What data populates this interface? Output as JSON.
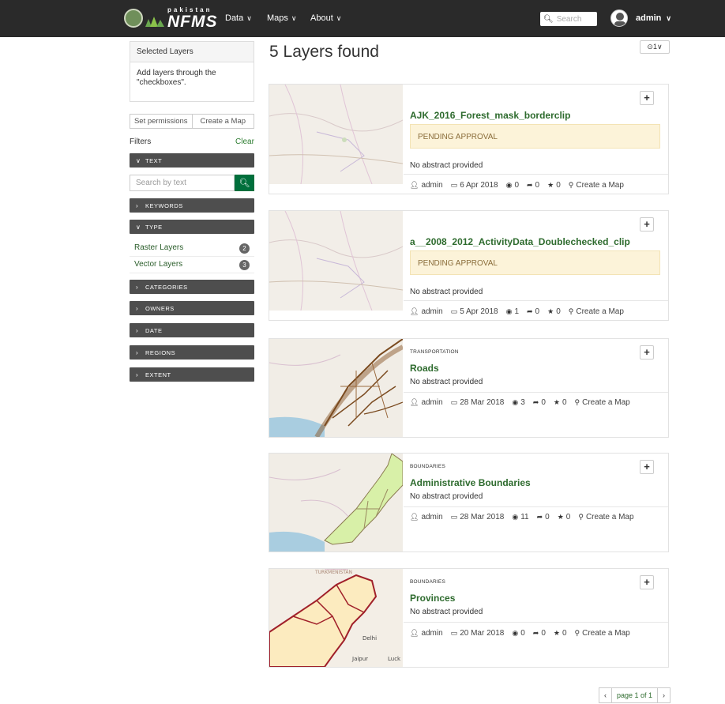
{
  "nav": {
    "logo_small": "pakistan",
    "logo_big": "NFMS",
    "menu": [
      "Data",
      "Maps",
      "About"
    ],
    "search_placeholder": "Search",
    "user": "admin"
  },
  "sidebar": {
    "selected_title": "Selected Layers",
    "selected_hint": "Add layers through the \"checkboxes\".",
    "set_permissions": "Set permissions",
    "create_map": "Create a Map",
    "filters_label": "Filters",
    "clear_label": "Clear",
    "facets": {
      "text": "TEXT",
      "keywords": "KEYWORDS",
      "type": "TYPE",
      "categories": "CATEGORIES",
      "owners": "OWNERS",
      "date": "DATE",
      "regions": "REGIONS",
      "extent": "EXTENT"
    },
    "search_placeholder": "Search by text",
    "types": [
      {
        "label": "Raster Layers",
        "count": "2"
      },
      {
        "label": "Vector Layers",
        "count": "3"
      }
    ]
  },
  "main": {
    "title": "5 Layers found",
    "sort_label": "⊙1∨",
    "layers": [
      {
        "category": "",
        "title": "AJK_2016_Forest_mask_borderclip",
        "status": "PENDING APPROVAL",
        "abstract": "No abstract provided",
        "owner": "admin",
        "date": "6 Apr 2018",
        "views": "0",
        "shares": "0",
        "rating": "0",
        "action": "Create a Map"
      },
      {
        "category": "",
        "title": "a__2008_2012_ActivityData_Doublechecked_clip",
        "status": "PENDING APPROVAL",
        "abstract": "No abstract provided",
        "owner": "admin",
        "date": "5 Apr 2018",
        "views": "1",
        "shares": "0",
        "rating": "0",
        "action": "Create a Map"
      },
      {
        "category": "TRANSPORTATION",
        "title": "Roads",
        "status": "",
        "abstract": "No abstract provided",
        "owner": "admin",
        "date": "28 Mar 2018",
        "views": "3",
        "shares": "0",
        "rating": "0",
        "action": "Create a Map"
      },
      {
        "category": "BOUNDARIES",
        "title": "Administrative Boundaries",
        "status": "",
        "abstract": "No abstract provided",
        "owner": "admin",
        "date": "28 Mar 2018",
        "views": "11",
        "shares": "0",
        "rating": "0",
        "action": "Create a Map"
      },
      {
        "category": "BOUNDARIES",
        "title": "Provinces",
        "status": "",
        "abstract": "No abstract provided",
        "owner": "admin",
        "date": "20 Mar 2018",
        "views": "0",
        "shares": "0",
        "rating": "0",
        "action": "Create a Map"
      }
    ],
    "map_labels": {
      "country": "Delhi",
      "city1": "Jaipur",
      "city2": "Luck",
      "top": "TURKMENISTAN"
    }
  },
  "pager": {
    "prev": "‹",
    "label": "page 1 of 1",
    "next": "›"
  }
}
